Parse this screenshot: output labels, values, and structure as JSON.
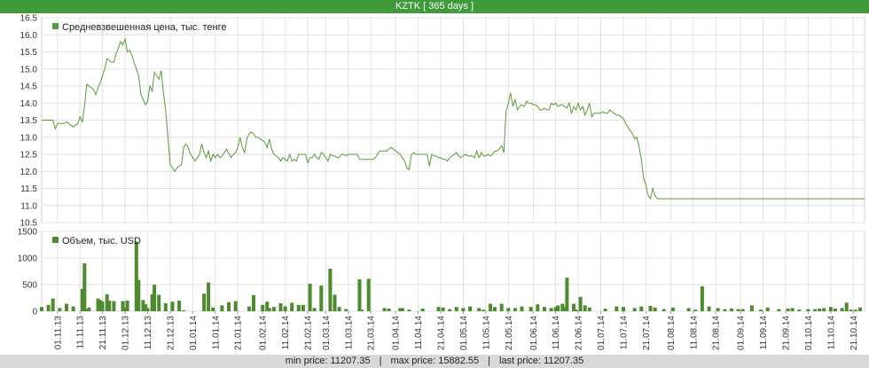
{
  "window": {
    "title": "KZTK [ 365 days ]"
  },
  "footer": {
    "min_label": "min price: 11207.35",
    "separator": "|",
    "max_label": "max price: 15882.55",
    "last_label": "last price: 11207.35"
  },
  "colors": {
    "accent": "#3f9a3a",
    "series": "#5a9a3a",
    "bars": "#4e8a2e",
    "grid": "#e1e1e1",
    "footer_bg": "#d9d9d9"
  },
  "chart_data": [
    {
      "type": "line",
      "legend": "Средневзвешенная цена, тыс. тенге",
      "legend_position": "top-left",
      "grid": true,
      "ylim": [
        10.5,
        16.5
      ],
      "yticks": [
        "16.5",
        "16.0",
        "15.5",
        "15.0",
        "14.5",
        "14.0",
        "13.5",
        "13.0",
        "12.5",
        "12.0",
        "11.5",
        "11.0",
        "10.5"
      ],
      "x_range_days": [
        0,
        365
      ],
      "x": [
        0,
        5,
        6,
        7,
        8,
        9,
        10,
        11,
        12,
        14,
        15,
        16,
        17,
        18,
        19,
        20,
        21,
        23,
        24,
        25,
        26,
        27,
        28,
        29,
        30,
        31,
        32,
        33,
        34,
        35,
        36,
        37,
        38,
        39,
        40,
        41,
        42,
        43,
        44,
        45,
        46,
        47,
        48,
        49,
        50,
        51,
        52,
        53,
        54,
        55,
        56,
        57,
        58,
        59,
        60,
        61,
        62,
        63,
        64,
        65,
        66,
        67,
        68,
        69,
        70,
        71,
        72,
        73,
        74,
        75,
        76,
        77,
        78,
        79,
        80,
        81,
        82,
        84,
        85,
        86,
        87,
        88,
        89,
        90,
        91,
        92,
        93,
        94,
        95,
        96,
        97,
        98,
        99,
        100,
        101,
        102,
        103,
        104,
        105,
        106,
        107,
        108,
        109,
        110,
        111,
        112,
        113,
        114,
        115,
        116,
        117,
        118,
        119,
        120,
        121,
        122,
        123,
        124,
        125,
        126,
        127,
        128,
        129,
        130,
        131,
        132,
        133,
        134,
        135,
        136,
        137,
        138,
        139,
        140,
        141,
        142,
        143,
        144,
        145,
        147,
        148,
        149,
        150,
        151,
        152,
        153,
        154,
        155,
        156,
        157,
        158,
        159,
        160,
        161,
        162,
        163,
        164,
        165,
        166,
        167,
        168,
        169,
        170,
        171,
        172,
        173,
        174,
        175,
        176,
        177,
        178,
        179,
        180,
        181,
        182,
        183,
        184,
        185,
        186,
        187,
        188,
        189,
        190,
        191,
        192,
        193,
        194,
        195,
        196,
        197,
        198,
        199,
        200,
        201,
        202,
        203,
        204,
        205,
        206,
        207,
        208,
        209,
        210,
        211,
        212,
        213,
        214,
        215,
        216,
        217,
        218,
        219,
        220,
        221,
        222,
        223,
        224,
        225,
        226,
        227,
        228,
        229,
        230,
        231,
        232,
        233,
        234,
        235,
        236,
        237,
        238,
        239,
        240,
        241,
        242,
        243,
        244,
        245,
        246,
        247,
        248,
        249,
        250,
        251,
        252,
        253,
        254,
        255,
        256,
        257,
        258,
        259,
        260,
        261,
        262,
        263,
        264,
        265,
        266,
        267,
        268,
        269,
        270,
        271,
        272,
        273,
        274,
        275,
        276,
        277,
        278,
        279,
        280,
        281,
        282,
        283,
        284,
        285,
        286,
        287,
        288,
        289,
        290,
        291,
        292,
        293,
        294,
        295,
        296,
        297,
        298,
        299,
        300,
        301,
        302,
        303,
        304,
        305,
        306,
        307,
        308,
        309,
        310,
        311,
        312,
        313,
        314,
        315,
        316,
        317,
        318,
        319,
        320,
        321,
        322,
        323,
        324,
        325,
        326,
        327,
        328,
        329,
        330,
        331,
        332,
        333,
        334,
        335,
        336,
        337,
        338,
        339,
        340,
        341,
        342,
        343,
        344,
        345,
        346,
        347,
        348,
        349,
        350,
        351,
        352,
        353,
        354,
        355,
        356,
        357,
        358,
        359,
        360,
        361,
        362,
        363,
        364,
        365
      ],
      "y": [
        13.5,
        13.5,
        13.25,
        13.4,
        13.4,
        13.4,
        13.4,
        13.45,
        13.4,
        13.3,
        13.35,
        13.4,
        13.6,
        13.45,
        13.9,
        14.55,
        14.5,
        14.4,
        14.25,
        14.45,
        14.6,
        14.8,
        15.0,
        15.3,
        15.25,
        15.2,
        15.2,
        15.45,
        15.6,
        15.8,
        15.7,
        15.88,
        15.5,
        15.55,
        15.4,
        15.2,
        15.0,
        14.8,
        14.25,
        14.1,
        13.95,
        14.05,
        14.5,
        14.35,
        14.9,
        14.8,
        14.7,
        14.95,
        14.3,
        13.8,
        13.0,
        12.2,
        12.1,
        12.0,
        12.1,
        12.15,
        12.2,
        12.7,
        12.8,
        12.7,
        12.5,
        12.4,
        12.3,
        12.4,
        12.5,
        12.8,
        12.55,
        12.4,
        12.6,
        12.3,
        12.5,
        12.4,
        12.5,
        12.4,
        12.45,
        12.55,
        12.65,
        12.4,
        12.5,
        12.55,
        12.7,
        13.0,
        12.7,
        12.55,
        12.95,
        13.1,
        13.15,
        13.1,
        13.0,
        13.0,
        12.95,
        12.9,
        12.85,
        12.7,
        12.95,
        12.65,
        12.5,
        12.45,
        12.4,
        12.3,
        12.4,
        12.35,
        12.3,
        12.5,
        12.3,
        12.35,
        12.3,
        12.5,
        12.5,
        12.5,
        12.5,
        12.25,
        12.4,
        12.4,
        12.5,
        12.4,
        12.35,
        12.55,
        12.5,
        12.4,
        12.3,
        12.5,
        12.45,
        12.45,
        12.4,
        12.4,
        12.5,
        12.5,
        12.45,
        12.5,
        12.5,
        12.5,
        12.5,
        12.5,
        12.35,
        12.35,
        12.35,
        12.35,
        12.35,
        12.35,
        12.4,
        12.5,
        12.6,
        12.6,
        12.6,
        12.6,
        12.65,
        12.7,
        12.65,
        12.6,
        12.55,
        12.5,
        12.4,
        12.3,
        12.1,
        12.05,
        12.5,
        12.55,
        12.5,
        12.5,
        12.5,
        12.5,
        12.5,
        12.5,
        12.15,
        12.5,
        12.45,
        12.45,
        12.4,
        12.4,
        12.35,
        12.35,
        12.3,
        12.4,
        12.45,
        12.5,
        12.55,
        12.45,
        12.4,
        12.45,
        12.5,
        12.45,
        12.45,
        12.45,
        12.4,
        12.6,
        12.4,
        12.55,
        12.45,
        12.45,
        12.5,
        12.45,
        12.5,
        12.6,
        12.6,
        12.65,
        12.75,
        12.55,
        13.75,
        14.0,
        14.3,
        13.9,
        14.1,
        13.8,
        13.9,
        13.95,
        13.9,
        14.05,
        14.0,
        14.0,
        13.95,
        13.95,
        13.9,
        13.8,
        13.8,
        13.85,
        13.8,
        13.8,
        14.0,
        13.95,
        14.0,
        13.9,
        13.95,
        13.95,
        13.9,
        13.85,
        14.0,
        13.7,
        13.9,
        13.8,
        14.0,
        13.8,
        13.9,
        13.65,
        13.8,
        14.0,
        13.6,
        13.7,
        13.7,
        13.7,
        13.7,
        13.75,
        13.7,
        13.7,
        13.8,
        13.75,
        13.7,
        13.65,
        13.65,
        13.6,
        13.55,
        13.4,
        13.3,
        13.2,
        13.1,
        12.95,
        13.0,
        12.7,
        12.35,
        11.8,
        11.6,
        11.3,
        11.2,
        11.5,
        11.3,
        11.2,
        11.2,
        11.2,
        11.2,
        11.2,
        11.2,
        11.2,
        11.2,
        11.2,
        11.2,
        11.2,
        11.2,
        11.2,
        11.2,
        11.2,
        11.2,
        11.2,
        11.2,
        11.2,
        11.2,
        11.2,
        11.2,
        11.2,
        11.2,
        11.2,
        11.2,
        11.2,
        11.2,
        11.2,
        11.2,
        11.2,
        11.2,
        11.2,
        11.2,
        11.2,
        11.2,
        11.2,
        11.2,
        11.2,
        11.2,
        11.2,
        11.2,
        11.2,
        11.2,
        11.2,
        11.2,
        11.2,
        11.2,
        11.2,
        11.2,
        11.2,
        11.2,
        11.2,
        11.2,
        11.2,
        11.2,
        11.2,
        11.2,
        11.2,
        11.2,
        11.2,
        11.2,
        11.2,
        11.2,
        11.2,
        11.2,
        11.2,
        11.2,
        11.2,
        11.2,
        11.2,
        11.2,
        11.2,
        11.2,
        11.2,
        11.2,
        11.2,
        11.2,
        11.2,
        11.2,
        11.2,
        11.2,
        11.2,
        11.2,
        11.2,
        11.2,
        11.2,
        11.2,
        11.2,
        11.2,
        11.2,
        11.2,
        11.2,
        11.2,
        11.2,
        11.2,
        11.2,
        11.2,
        11.2,
        11.2,
        11.2,
        11.2,
        11.2,
        11.2
      ]
    },
    {
      "type": "bar",
      "legend": "Объем, тыс. USD",
      "legend_position": "top-left",
      "grid": true,
      "ylim": [
        0,
        1500
      ],
      "yticks": [
        "1500",
        "1000",
        "500",
        "0"
      ],
      "x_range_days": [
        0,
        365
      ],
      "x": [
        0,
        3,
        5,
        8,
        11,
        14,
        18,
        19,
        20,
        21,
        25,
        26,
        27,
        29,
        30,
        32,
        36,
        37,
        38,
        42,
        43,
        45,
        46,
        47,
        49,
        50,
        52,
        55,
        58,
        61,
        63,
        72,
        74,
        76,
        80,
        83,
        86,
        92,
        94,
        98,
        100,
        101,
        103,
        106,
        108,
        111,
        114,
        116,
        119,
        121,
        124,
        128,
        130,
        132,
        135,
        141,
        142,
        145,
        152,
        154,
        159,
        160,
        163,
        169,
        176,
        178,
        181,
        184,
        187,
        190,
        194,
        196,
        199,
        201,
        204,
        207,
        210,
        213,
        217,
        220,
        223,
        226,
        228,
        229,
        231,
        232,
        233,
        236,
        237,
        239,
        241,
        243,
        250,
        255,
        258,
        263,
        266,
        270,
        272,
        276,
        280,
        287,
        290,
        293,
        296,
        300,
        303,
        306,
        309,
        311,
        315,
        319,
        322,
        327,
        331,
        333,
        336,
        340,
        343,
        345,
        347,
        350,
        352,
        355,
        357,
        359,
        361,
        363,
        365
      ],
      "values": [
        80,
        120,
        240,
        60,
        140,
        90,
        420,
        900,
        40,
        70,
        240,
        210,
        180,
        320,
        200,
        190,
        190,
        70,
        200,
        1310,
        590,
        210,
        130,
        60,
        320,
        500,
        310,
        150,
        180,
        200,
        20,
        330,
        540,
        70,
        110,
        170,
        190,
        90,
        300,
        120,
        180,
        60,
        80,
        150,
        90,
        160,
        120,
        120,
        520,
        60,
        480,
        800,
        310,
        80,
        40,
        600,
        30,
        610,
        60,
        50,
        60,
        60,
        30,
        50,
        80,
        70,
        40,
        80,
        60,
        90,
        60,
        30,
        140,
        80,
        140,
        60,
        60,
        90,
        80,
        130,
        80,
        60,
        80,
        110,
        140,
        80,
        630,
        140,
        30,
        270,
        110,
        70,
        50,
        90,
        80,
        60,
        90,
        100,
        70,
        40,
        70,
        60,
        30,
        470,
        90,
        60,
        40,
        50,
        40,
        40,
        110,
        30,
        70,
        40,
        50,
        60,
        30,
        40,
        40,
        50,
        60,
        80,
        50,
        60,
        160,
        30,
        30,
        70
      ]
    }
  ],
  "x_axis": {
    "tick_labels": [
      "01.11.13",
      "11.11.13",
      "21.11.13",
      "01.12.13",
      "11.12.13",
      "21.12.13",
      "01.01.14",
      "11.01.14",
      "21.01.14",
      "01.02.14",
      "11.02.14",
      "21.02.14",
      "01.03.14",
      "11.03.14",
      "21.03.14",
      "01.04.14",
      "11.04.14",
      "21.04.14",
      "01.05.14",
      "11.05.14",
      "21.05.14",
      "01.06.14",
      "11.06.14",
      "21.06.14",
      "01.07.14",
      "11.07.14",
      "21.07.14",
      "01.08.14",
      "11.08.14",
      "21.08.14",
      "01.09.14",
      "11.09.14",
      "21.09.14",
      "01.10.14",
      "11.10.14",
      "21.10.14"
    ],
    "tick_days": [
      7,
      17,
      27,
      37,
      47,
      57,
      67,
      77,
      87,
      98,
      108,
      118,
      126,
      136,
      146,
      157,
      167,
      177,
      187,
      197,
      207,
      218,
      228,
      238,
      248,
      258,
      268,
      279,
      289,
      299,
      310,
      320,
      330,
      340,
      350,
      360
    ]
  }
}
